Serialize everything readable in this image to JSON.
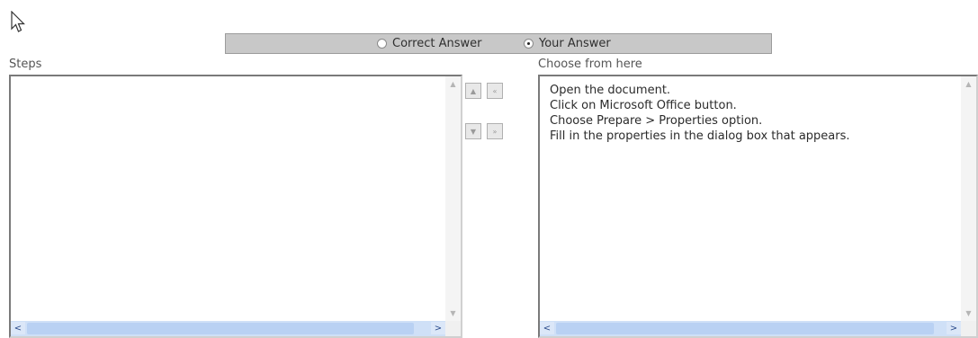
{
  "answer_mode": {
    "options": [
      {
        "label": "Correct Answer",
        "selected": false
      },
      {
        "label": "Your Answer",
        "selected": true
      }
    ]
  },
  "steps": {
    "label": "Steps",
    "items": []
  },
  "choose": {
    "label": "Choose from here",
    "items": [
      "Open the document.",
      "Click on Microsoft Office button.",
      "Choose Prepare > Properties option.",
      "Fill in the properties in the dialog box that appears."
    ]
  },
  "controls": {
    "move_up": "▲",
    "remove_all": "«",
    "move_down": "▼",
    "add_all": "»"
  },
  "scroll": {
    "up": "▲",
    "down": "▼",
    "left": "<",
    "right": ">"
  },
  "icons": {
    "cursor": "mouse-pointer-icon"
  }
}
